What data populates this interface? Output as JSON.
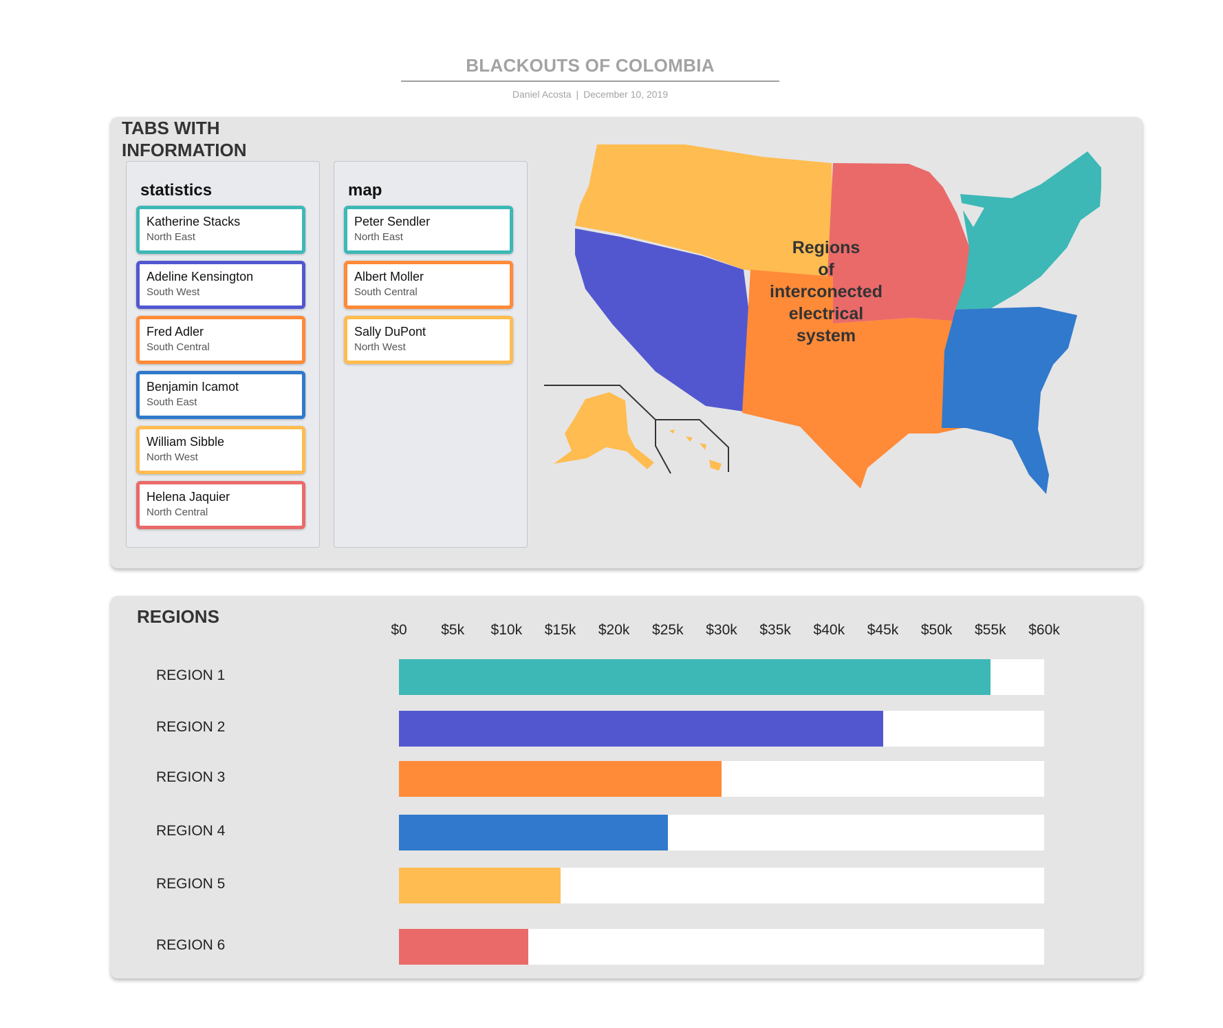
{
  "header": {
    "title": "BLACKOUTS OF COLOMBIA",
    "author": "Daniel Acosta",
    "separator": "|",
    "date": "December 10, 2019"
  },
  "tabs_panel": {
    "title": "TABS WITH INFORMATION",
    "statistics": {
      "title": "statistics",
      "cards": [
        {
          "name": "Katherine Stacks",
          "region": "North East",
          "color": "#3db8b6"
        },
        {
          "name": "Adeline Kensington",
          "region": "South West",
          "color": "#5257d0"
        },
        {
          "name": "Fred Adler",
          "region": "South Central",
          "color": "#ff8a38"
        },
        {
          "name": "Benjamin Icamot",
          "region": "South East",
          "color": "#3079cc"
        },
        {
          "name": "William Sibble",
          "region": "North West",
          "color": "#ffbc50"
        },
        {
          "name": "Helena Jaquier",
          "region": "North Central",
          "color": "#ea6a6a"
        }
      ]
    },
    "map": {
      "title": "map",
      "cards": [
        {
          "name": "Peter Sendler",
          "region": "North East",
          "color": "#3db8b6"
        },
        {
          "name": "Albert Moller",
          "region": "South Central",
          "color": "#ff8a38"
        },
        {
          "name": "Sally DuPont",
          "region": "North West",
          "color": "#ffbc50"
        }
      ]
    },
    "map_label_lines": [
      "Regions",
      "of",
      "interconected",
      "electrical",
      "system"
    ]
  },
  "chart_data": {
    "type": "bar",
    "title": "REGIONS",
    "orientation": "horizontal",
    "categories": [
      "REGION 1",
      "REGION 2",
      "REGION 3",
      "REGION 4",
      "REGION 5",
      "REGION 6"
    ],
    "values": [
      55000,
      45000,
      30000,
      25000,
      15000,
      12000
    ],
    "colors": [
      "#3db8b6",
      "#5257d0",
      "#ff8a38",
      "#3079cc",
      "#ffbc50",
      "#ea6a6a"
    ],
    "xlim": [
      0,
      60000
    ],
    "x_ticks": [
      "$0",
      "$5k",
      "$10k",
      "$15k",
      "$20k",
      "$25k",
      "$30k",
      "$35k",
      "$40k",
      "$45k",
      "$50k",
      "$55k",
      "$60k"
    ],
    "grid": false,
    "legend": "none"
  }
}
